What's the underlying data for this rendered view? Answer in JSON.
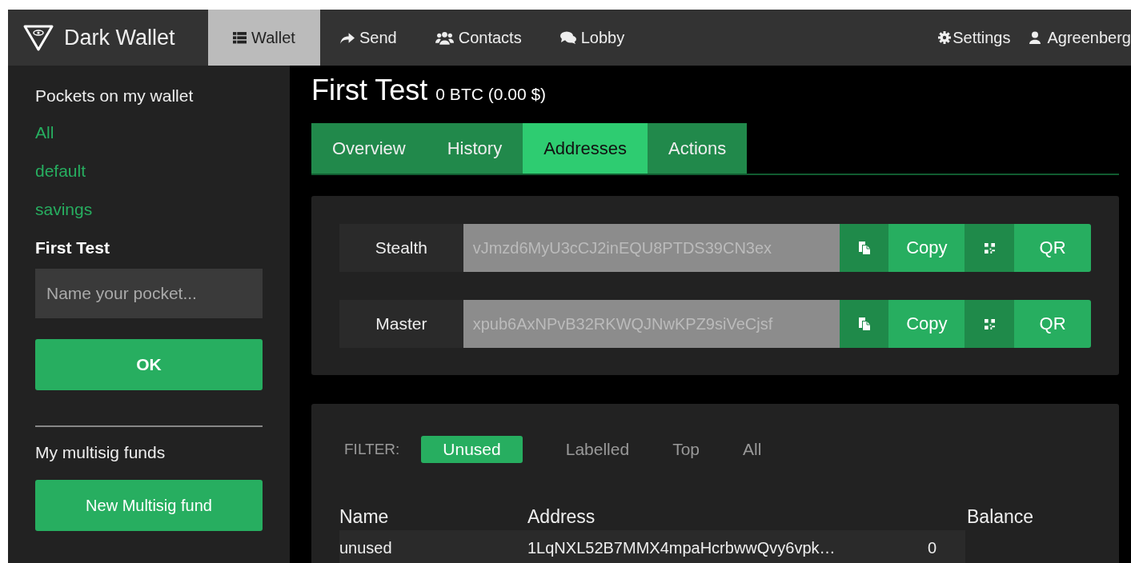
{
  "brand": {
    "name": "Dark Wallet"
  },
  "nav": [
    {
      "label": "Wallet",
      "selected": true
    },
    {
      "label": "Send",
      "selected": false
    },
    {
      "label": "Contacts",
      "selected": false
    },
    {
      "label": "Lobby",
      "selected": false
    }
  ],
  "nav_right": [
    {
      "label": "Settings"
    },
    {
      "label": "Agreenberg"
    }
  ],
  "sidebar": {
    "heading": "Pockets on my wallet",
    "pockets": [
      {
        "label": "All",
        "selected": false
      },
      {
        "label": "default",
        "selected": false
      },
      {
        "label": "savings",
        "selected": false
      },
      {
        "label": "First Test",
        "selected": true
      }
    ],
    "name_field": {
      "placeholder": "Name your pocket..."
    },
    "ok_button": "OK",
    "multisig_heading": "My multisig funds",
    "multisig_button": "New Multisig fund"
  },
  "pocket": {
    "title": "First Test",
    "balance": "0 BTC (0.00 $)"
  },
  "tabs": [
    {
      "label": "Overview",
      "selected": false
    },
    {
      "label": "History",
      "selected": false
    },
    {
      "label": "Addresses",
      "selected": true
    },
    {
      "label": "Actions",
      "selected": false
    }
  ],
  "keys": [
    {
      "label": "Stealth",
      "value": "vJmzd6MyU3cCJ2inEQU8PTDS39CN3ex",
      "copy": "Copy",
      "qr": "QR"
    },
    {
      "label": "Master",
      "value": "xpub6AxNPvB32RKWQJNwKPZ9siVeCjsf",
      "copy": "Copy",
      "qr": "QR"
    }
  ],
  "filter": {
    "label": "FILTER:",
    "options": [
      {
        "label": "Unused",
        "selected": true
      },
      {
        "label": "Labelled",
        "selected": false
      },
      {
        "label": "Top",
        "selected": false
      },
      {
        "label": "All",
        "selected": false
      }
    ]
  },
  "table": {
    "columns": [
      "Name",
      "Address",
      "Balance"
    ],
    "rows": [
      {
        "name": "unused",
        "address": "1LqNXL52B7MMX4mpaHcrbwwQvy6vpk…",
        "balance": "0"
      }
    ]
  }
}
